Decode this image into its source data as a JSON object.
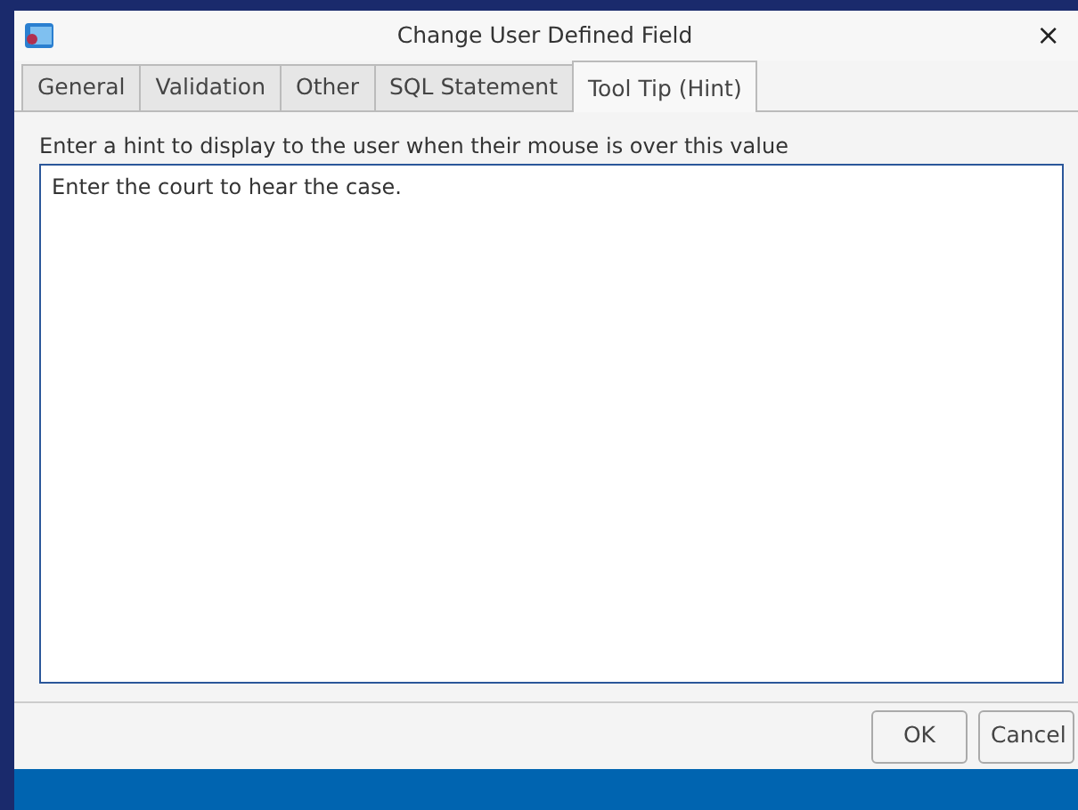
{
  "window": {
    "title": "Change User Defined Field",
    "close": "×"
  },
  "tabs": [
    {
      "label": "General",
      "selected": false
    },
    {
      "label": "Validation",
      "selected": false
    },
    {
      "label": "Other",
      "selected": false
    },
    {
      "label": "SQL Statement",
      "selected": false
    },
    {
      "label": "Tool Tip (Hint)",
      "selected": true
    }
  ],
  "hint": {
    "label": "Enter a hint to display to the user when their mouse is over this value",
    "value": "Enter the court to hear the case."
  },
  "buttons": [
    "OK",
    "Cancel"
  ]
}
